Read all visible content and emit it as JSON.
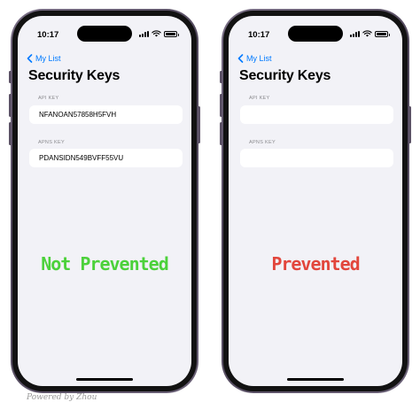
{
  "status_bar": {
    "time": "10:17"
  },
  "nav": {
    "back_label": "My List"
  },
  "page": {
    "title": "Security Keys"
  },
  "left_phone": {
    "fields": [
      {
        "label": "API KEY",
        "value": "NFANOAN57858H5FVH"
      },
      {
        "label": "APNS KEY",
        "value": "PDANSIDN549BVFF55VU"
      }
    ],
    "overlay": "Not Prevented"
  },
  "right_phone": {
    "fields": [
      {
        "label": "API KEY",
        "value": ""
      },
      {
        "label": "APNS KEY",
        "value": ""
      }
    ],
    "overlay": "Prevented"
  },
  "watermark": "Powered by Zhou",
  "colors": {
    "accent": "#007aff",
    "not_prevented": "#4cd13b",
    "prevented": "#e2463c",
    "background": "#f2f2f7"
  },
  "icons": [
    "chevron-left-icon",
    "signal-icon",
    "wifi-icon",
    "battery-icon"
  ]
}
